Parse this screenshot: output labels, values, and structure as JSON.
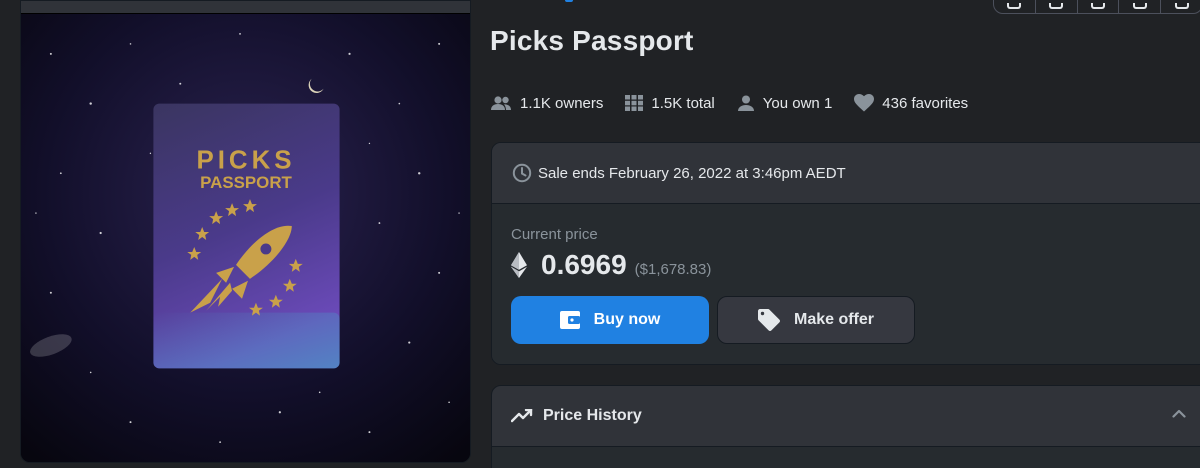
{
  "item": {
    "title": "Picks Passport",
    "cover_text_line1": "PICKS",
    "cover_text_line2": "PASSPORT"
  },
  "stats": {
    "owners": "1.1K owners",
    "total": "1.5K total",
    "you_own": "You own 1",
    "favorites": "436 favorites"
  },
  "sale": {
    "ends_text": "Sale ends February 26, 2022 at 3:46pm AEDT",
    "current_price_label": "Current price",
    "price": "0.6969",
    "usd": "($1,678.83)",
    "buy_label": "Buy now",
    "offer_label": "Make offer"
  },
  "history": {
    "title": "Price History"
  },
  "icons": {
    "owners": "people-icon",
    "total": "grid-icon",
    "you_own": "person-icon",
    "favorites": "heart-icon",
    "sale": "clock-icon",
    "price": "ethereum-icon",
    "buy": "wallet-icon",
    "offer": "tag-icon",
    "history": "trending-icon",
    "collapse": "chevron-up-icon"
  },
  "colors": {
    "accent": "#2081e2",
    "background": "#202225",
    "panel": "#303339",
    "muted": "#8a939b",
    "cover_gold": "#c9a14a"
  }
}
